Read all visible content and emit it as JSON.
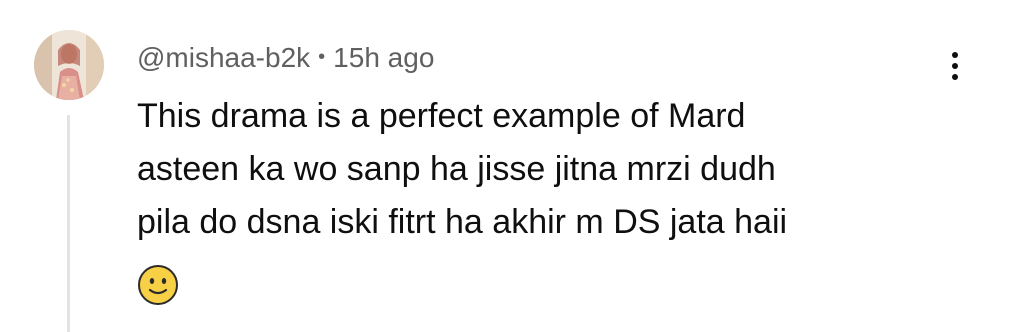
{
  "comment": {
    "author": "@mishaa-b2k",
    "separator": "•",
    "timestamp": "15h ago",
    "text_lines": [
      "This drama is a perfect example of Mard",
      "asteen ka wo sanp ha jisse jitna mrzi dudh",
      "pila do dsna iski fitrt ha akhir m DS jata haii"
    ],
    "emoji": "slightly-smiling-face",
    "more_icon": "more-vertical-icon"
  },
  "colors": {
    "meta_text": "#606060",
    "body_text": "#0f0f0f",
    "emoji_fill": "#f7d046",
    "thread_line": "#e3e3e3"
  }
}
